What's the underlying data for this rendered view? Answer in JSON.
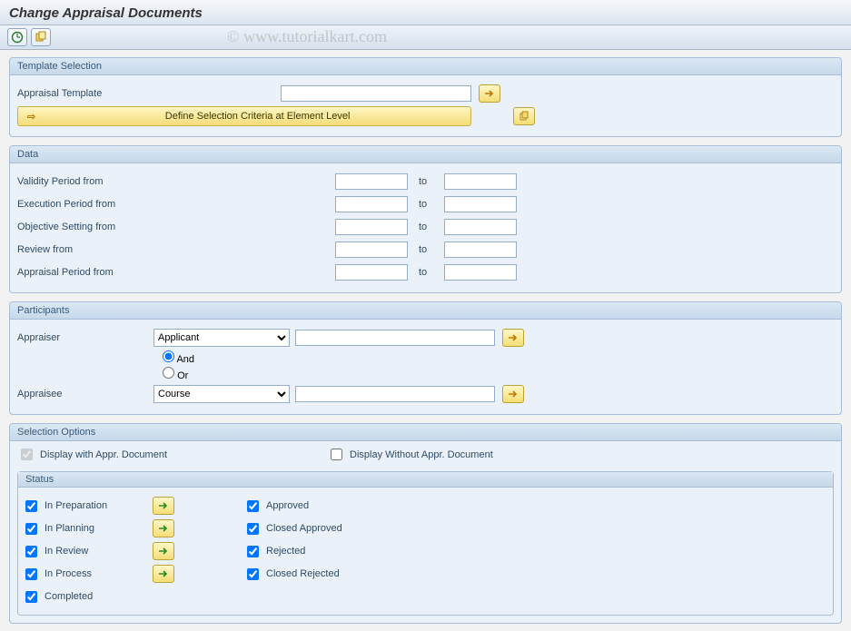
{
  "title": "Change Appraisal Documents",
  "watermark": "© www.tutorialkart.com",
  "groups": {
    "template": {
      "title": "Template Selection",
      "field_label": "Appraisal Template",
      "field_value": "",
      "define_button": "Define Selection Criteria at Element Level"
    },
    "data": {
      "title": "Data",
      "rows": [
        {
          "label": "Validity Period from",
          "from": "",
          "to_label": "to",
          "to": ""
        },
        {
          "label": "Execution Period from",
          "from": "",
          "to_label": "to",
          "to": ""
        },
        {
          "label": "Objective Setting from",
          "from": "",
          "to_label": "to",
          "to": ""
        },
        {
          "label": "Review from",
          "from": "",
          "to_label": "to",
          "to": ""
        },
        {
          "label": "Appraisal Period from",
          "from": "",
          "to_label": "to",
          "to": ""
        }
      ]
    },
    "participants": {
      "title": "Participants",
      "appraiser_label": "Appraiser",
      "appraiser_type": "Applicant",
      "appraiser_value": "",
      "logic_and": "And",
      "logic_or": "Or",
      "logic_selected": "And",
      "appraisee_label": "Appraisee",
      "appraisee_type": "Course",
      "appraisee_value": ""
    },
    "selection": {
      "title": "Selection Options",
      "display_with": "Display with Appr. Document",
      "display_with_checked": true,
      "display_without": "Display Without Appr. Document",
      "display_without_checked": false,
      "status_title": "Status",
      "left": [
        {
          "label": "In Preparation",
          "checked": true,
          "arrow": true
        },
        {
          "label": "In Planning",
          "checked": true,
          "arrow": true
        },
        {
          "label": "In Review",
          "checked": true,
          "arrow": true
        },
        {
          "label": "In Process",
          "checked": true,
          "arrow": true
        },
        {
          "label": "Completed",
          "checked": true,
          "arrow": false
        }
      ],
      "right": [
        {
          "label": "Approved",
          "checked": true
        },
        {
          "label": "Closed Approved",
          "checked": true
        },
        {
          "label": "Rejected",
          "checked": true
        },
        {
          "label": "Closed Rejected",
          "checked": true
        }
      ]
    }
  }
}
